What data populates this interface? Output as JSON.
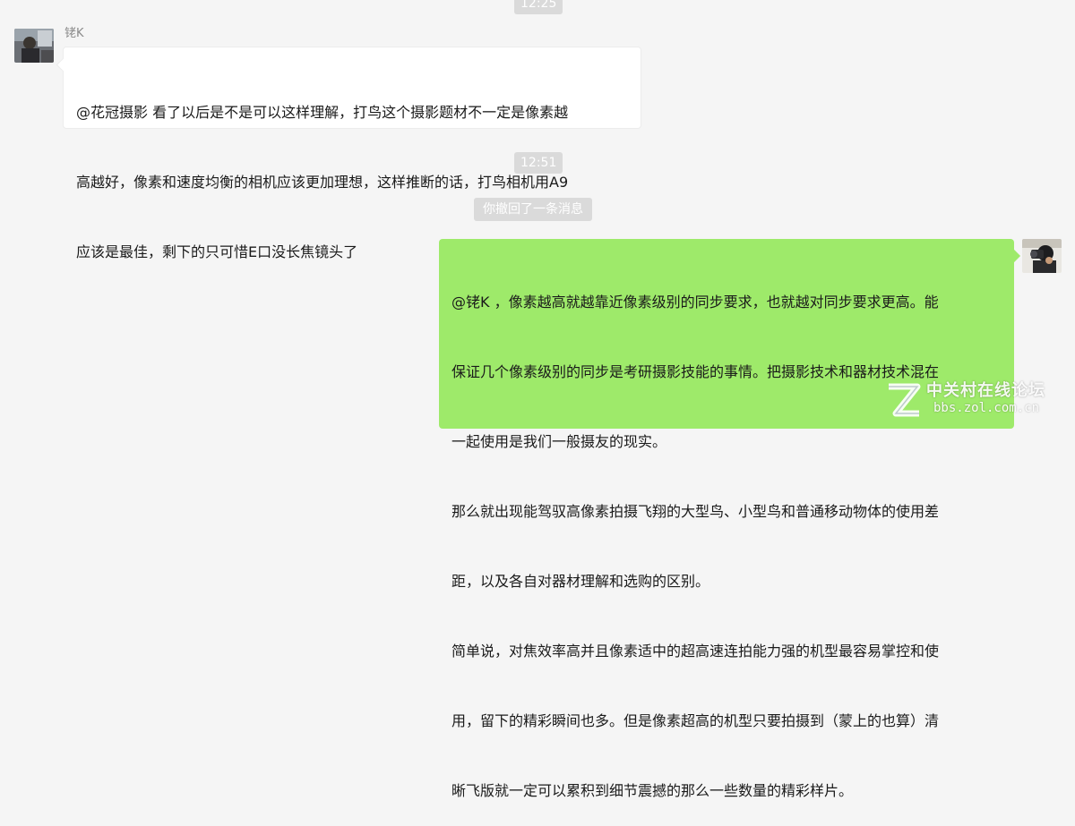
{
  "timestamps": [
    "12:25",
    "12:51"
  ],
  "recall_notice": "你撤回了一条消息",
  "messages": [
    {
      "sender": "铑K",
      "side": "left",
      "lines": [
        "@花冠摄影 看了以后是不是可以这样理解，打鸟这个摄影题材不一定是像素越",
        "高越好，像素和速度均衡的相机应该更加理想，这样推断的话，打鸟相机用A9",
        "应该是最佳，剩下的只可惜E口没长焦镜头了"
      ]
    },
    {
      "sender": "",
      "side": "right",
      "lines": [
        "@铑K ，像素越高就越靠近像素级别的同步要求，也就越对同步要求更高。能",
        "保证几个像素级别的同步是考研摄影技能的事情。把摄影技术和器材技术混在",
        "一起使用是我们一般摄友的现实。",
        "那么就出现能驾驭高像素拍摄飞翔的大型鸟、小型鸟和普通移动物体的使用差",
        "距，以及各自对器材理解和选购的区别。",
        "简单说，对焦效率高并且像素适中的超高速连拍能力强的机型最容易掌控和使",
        "用，留下的精彩瞬间也多。但是像素超高的机型只要拍摄到（蒙上的也算）清",
        "晰飞版就一定可以累积到细节震撼的那么一些数量的精彩样片。"
      ]
    }
  ],
  "watermark": {
    "title": "中关村在线论坛",
    "url": "bbs.zol.com.cn"
  },
  "colors": {
    "background": "#f5f5f5",
    "left_bubble": "#ffffff",
    "right_bubble": "#9eea6a",
    "pill": "#dadada"
  },
  "icons": [
    "avatar-left",
    "avatar-right",
    "zol-logo-icon"
  ]
}
